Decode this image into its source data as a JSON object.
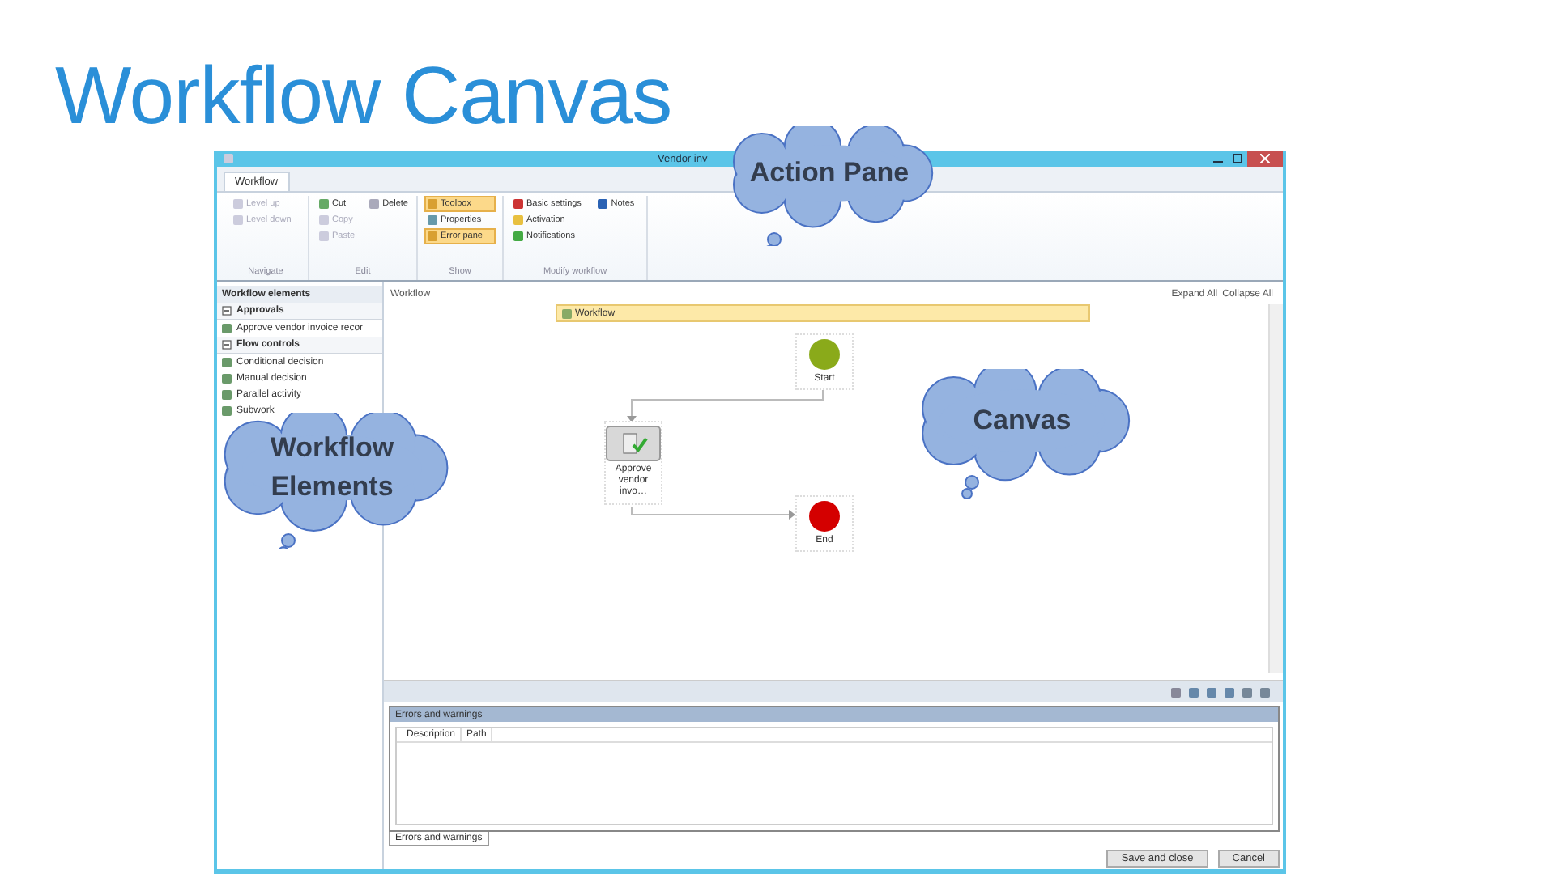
{
  "slide_title": "Workflow Canvas",
  "window": {
    "title": "Vendor inv"
  },
  "ribbon": {
    "tabs": [
      {
        "label": "Workflow",
        "selected": true
      }
    ],
    "groups": [
      {
        "label": "Navigate",
        "items": [
          {
            "label": "Level up",
            "disabled": true,
            "selected": false
          },
          {
            "label": "Level down",
            "disabled": true,
            "selected": false
          }
        ]
      },
      {
        "label": "Edit",
        "items": [
          {
            "label": "Cut",
            "disabled": false,
            "selected": false
          },
          {
            "label": "Copy",
            "disabled": true,
            "selected": false
          },
          {
            "label": "Paste",
            "disabled": true,
            "selected": false
          },
          {
            "label": "Delete",
            "disabled": false,
            "selected": false
          }
        ]
      },
      {
        "label": "Show",
        "items": [
          {
            "label": "Toolbox",
            "disabled": false,
            "selected": true
          },
          {
            "label": "Properties",
            "disabled": false,
            "selected": false
          },
          {
            "label": "Error pane",
            "disabled": false,
            "selected": true
          }
        ]
      },
      {
        "label": "Modify workflow",
        "items": [
          {
            "label": "Basic settings",
            "disabled": false,
            "selected": false
          },
          {
            "label": "Activation",
            "disabled": false,
            "selected": false
          },
          {
            "label": "Notifications",
            "disabled": false,
            "selected": false
          },
          {
            "label": "Notes",
            "disabled": false,
            "selected": false
          }
        ]
      }
    ]
  },
  "elements": {
    "title": "Workflow elements",
    "sections": [
      {
        "label": "Approvals",
        "expanded": true,
        "items": [
          "Approve vendor invoice recor"
        ]
      },
      {
        "label": "Flow controls",
        "expanded": true,
        "items": [
          "Conditional decision",
          "Manual decision",
          "Parallel activity",
          "Subwork"
        ]
      }
    ]
  },
  "canvas": {
    "label": "Workflow",
    "breadcrumb": "Workflow",
    "links": [
      "Expand All",
      "Collapse All"
    ],
    "nodes": [
      {
        "kind": "start",
        "label": "Start"
      },
      {
        "kind": "task",
        "label": "Approve vendor invo…"
      },
      {
        "kind": "end",
        "label": "End"
      }
    ]
  },
  "error_pane": {
    "title": "Errors and warnings",
    "columns": [
      "Description",
      "Path"
    ],
    "tabs": [
      {
        "label": "Errors and warnings",
        "selected": true
      }
    ]
  },
  "buttons": [
    "Save and close",
    "Cancel"
  ],
  "callouts": [
    {
      "label": "Action Pane"
    },
    {
      "label": "Canvas"
    },
    {
      "label": "Workflow Elements"
    }
  ]
}
